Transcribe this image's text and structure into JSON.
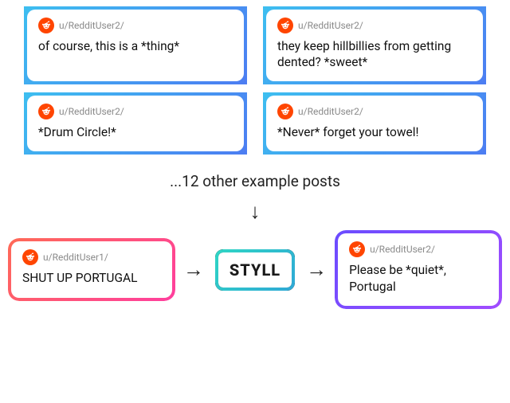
{
  "topCards": [
    {
      "user": "u/RedditUser2/",
      "text": "of course, this is a *thing*"
    },
    {
      "user": "u/RedditUser2/",
      "text": "they keep hillbillies from getting dented? *sweet*"
    }
  ],
  "midCards": [
    {
      "user": "u/RedditUser2/",
      "text": "*Drum Circle!*"
    },
    {
      "user": "u/RedditUser2/",
      "text": "*Never* forget your towel!"
    }
  ],
  "caption": "...12 other example posts",
  "arrowDown": "↓",
  "arrowRight": "→",
  "bottom": {
    "left": {
      "user": "u/RedditUser1/",
      "text": "SHUT UP PORTUGAL"
    },
    "center": "STYLL",
    "right": {
      "user": "u/RedditUser2/",
      "text": "Please be *quiet*, Portugal"
    }
  },
  "figureCaption": ""
}
